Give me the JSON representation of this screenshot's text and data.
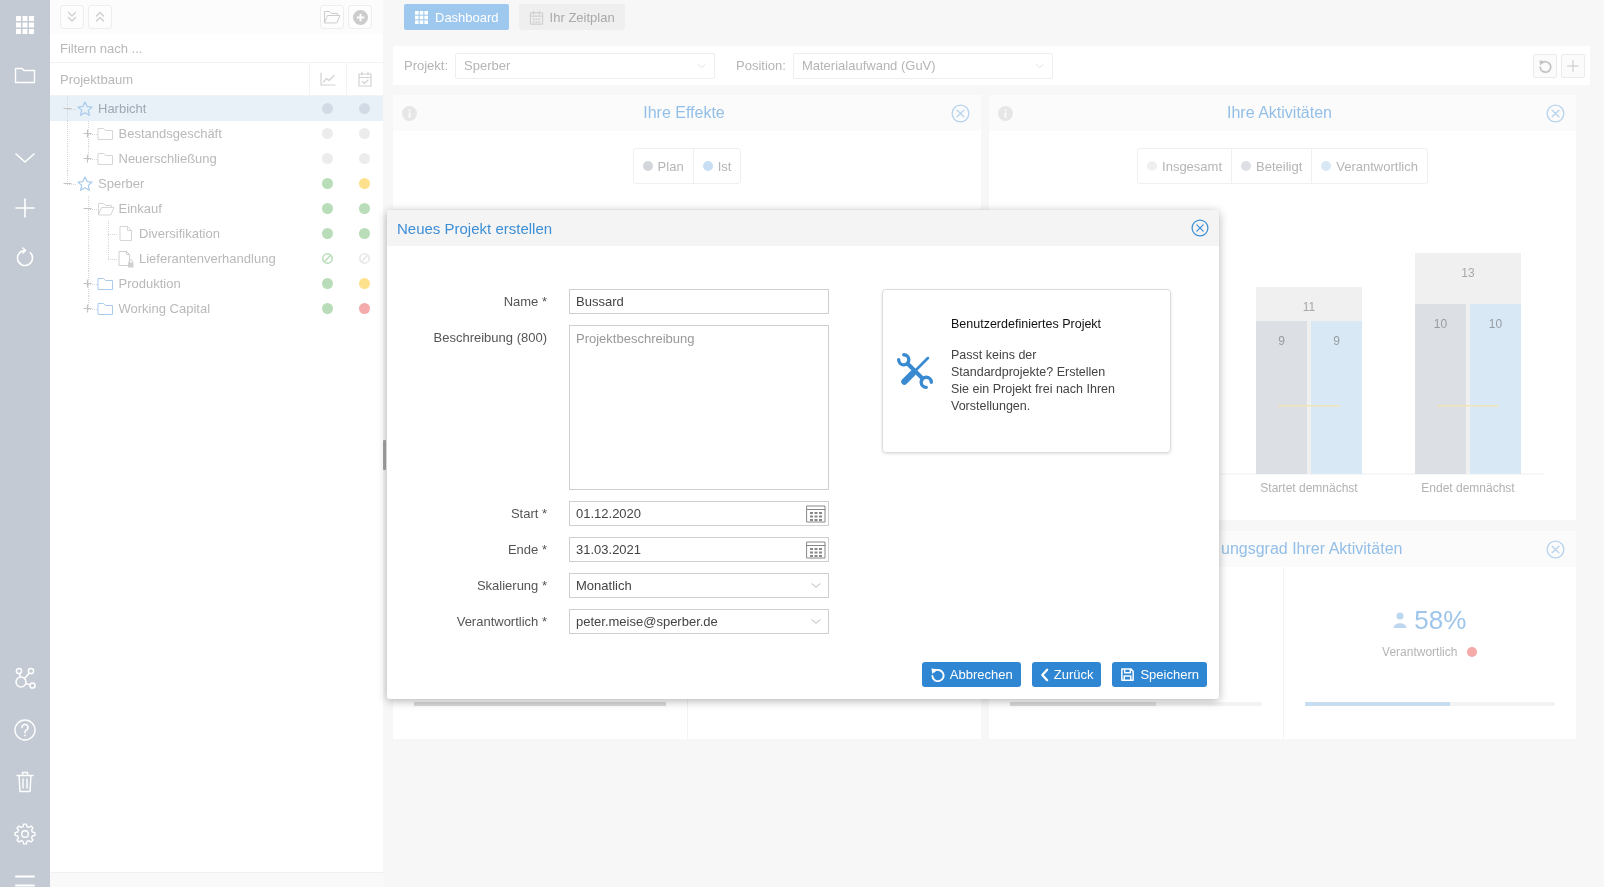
{
  "tree": {
    "filter": {
      "placeholder": "Filtern nach ..."
    },
    "title": "Projektbaum",
    "items": [
      {
        "label": "Harbicht",
        "kind": "project",
        "color": "#a6caec",
        "selected": true,
        "expanded": true,
        "status": [
          {
            "kind": "dot",
            "color": "#d2dbe5"
          },
          {
            "kind": "dot",
            "color": "#d2dbe5"
          }
        ],
        "children": [
          {
            "label": "Bestandsgeschäft",
            "kind": "folder",
            "color": "#d6d6d6",
            "selected": false,
            "expanded": false,
            "status": [
              {
                "kind": "dot",
                "color": "#ececec"
              },
              {
                "kind": "dot",
                "color": "#ececec"
              }
            ]
          },
          {
            "label": "Neuerschließung",
            "kind": "folder",
            "color": "#d6d6d6",
            "selected": false,
            "expanded": false,
            "status": [
              {
                "kind": "dot",
                "color": "#ececec"
              },
              {
                "kind": "dot",
                "color": "#ececec"
              }
            ]
          }
        ]
      },
      {
        "label": "Sperber",
        "kind": "project",
        "color": "#a6caec",
        "selected": false,
        "expanded": true,
        "status": [
          {
            "kind": "dot",
            "color": "#b8ddb8"
          },
          {
            "kind": "dot",
            "color": "#fde18c"
          }
        ],
        "children": [
          {
            "label": "Einkauf",
            "kind": "folder",
            "color": "#d6d6d6",
            "selected": false,
            "expanded": true,
            "status": [
              {
                "kind": "dot",
                "color": "#b8ddb8"
              },
              {
                "kind": "dot",
                "color": "#b8ddb8"
              }
            ],
            "children": [
              {
                "label": "Diversifikation",
                "kind": "task",
                "color": "#d6d6d6",
                "selected": false,
                "status": [
                  {
                    "kind": "dot",
                    "color": "#b8ddb8"
                  },
                  {
                    "kind": "dot",
                    "color": "#b8ddb8"
                  }
                ]
              },
              {
                "label": "Lieferantenverhandlung",
                "kind": "locked-task",
                "color": "#d0d0d0",
                "selected": false,
                "status": [
                  {
                    "kind": "blocked",
                    "color": "#b5dcb5"
                  },
                  {
                    "kind": "blocked",
                    "color": "#e6e6e6"
                  }
                ]
              }
            ]
          },
          {
            "label": "Produktion",
            "kind": "folder",
            "color": "#a9cbee",
            "selected": false,
            "expanded": false,
            "status": [
              {
                "kind": "dot",
                "color": "#b8ddb8"
              },
              {
                "kind": "dot",
                "color": "#fde18c"
              }
            ]
          },
          {
            "label": "Working Capital",
            "kind": "folder",
            "color": "#a9cbee",
            "selected": false,
            "expanded": false,
            "status": [
              {
                "kind": "dot",
                "color": "#b8ddb8"
              },
              {
                "kind": "dot",
                "color": "#f5abab"
              }
            ]
          }
        ]
      }
    ]
  },
  "tabs": [
    {
      "label": "Dashboard",
      "kind": "dashboard",
      "selected": true
    },
    {
      "label": "Ihr Zeitplan",
      "kind": "schedule",
      "selected": false
    }
  ],
  "filters": [
    {
      "label": "Projekt:",
      "value": "Sperber"
    },
    {
      "label": "Position:",
      "value": "Materialaufwand (GuV)"
    }
  ],
  "panels": [
    {
      "kind": "chart",
      "title": "Ihre Effekte",
      "legend": [
        {
          "label": "Plan",
          "color": "#d3d6da"
        },
        {
          "label": "Ist",
          "color": "#c8def2"
        }
      ]
    },
    {
      "kind": "chart",
      "title": "Ihre Aktivitäten",
      "chart_data": {
        "type": "bar",
        "categories": [
          "Startet demnächst",
          "Endet demnächst"
        ],
        "series": [
          {
            "name": "Insgesamt",
            "color": "#f0f0f0",
            "values": [
              11,
              13
            ]
          },
          {
            "name": "Beteiligt",
            "color": "#dcdfe3",
            "values": [
              9,
              10
            ]
          },
          {
            "name": "Verantwortlich",
            "color": "#d9e8f5",
            "values": [
              9,
              10
            ]
          }
        ],
        "data_labels": true
      }
    },
    {
      "kind": "progress",
      "columns": [
        {
          "bar": {
            "level": 1,
            "color": "#dadada"
          }
        }
      ]
    },
    {
      "kind": "progress",
      "title": "ungsgrad Ihrer Aktivitäten",
      "columns": [
        {
          "bar": {
            "level": 0.58,
            "color": "#dadada"
          }
        },
        {
          "value": "58%",
          "label": "Verantwortlich",
          "status": {
            "color": "#f5a9a9"
          },
          "bar": {
            "level": 0.58,
            "color": "#c6ddf2"
          }
        }
      ]
    }
  ],
  "dialog": {
    "title": "Neues Projekt erstellen",
    "fields": [
      {
        "label": "Name *",
        "kind": "text",
        "value": "Bussard"
      },
      {
        "label": "Beschreibung (800)",
        "kind": "textarea",
        "placeholder": "Projektbeschreibung"
      },
      {
        "label": "Start *",
        "kind": "date",
        "value": "01.12.2020"
      },
      {
        "label": "Ende *",
        "kind": "date",
        "value": "31.03.2021"
      },
      {
        "label": "Skalierung *",
        "kind": "select",
        "value": "Monatlich"
      },
      {
        "label": "Verantwortlich *",
        "kind": "select",
        "value": "peter.meise@sperber.de"
      }
    ],
    "template": {
      "title": "Benutzerdefiniertes Projekt",
      "description": "Passt keins der Standardprojekte? Erstellen Sie ein Projekt frei nach Ihren Vorstellungen."
    },
    "buttons": [
      {
        "label": "Abbrechen",
        "kind": "cancel"
      },
      {
        "label": "Zurück",
        "kind": "back"
      },
      {
        "label": "Speichern",
        "kind": "save"
      }
    ]
  }
}
